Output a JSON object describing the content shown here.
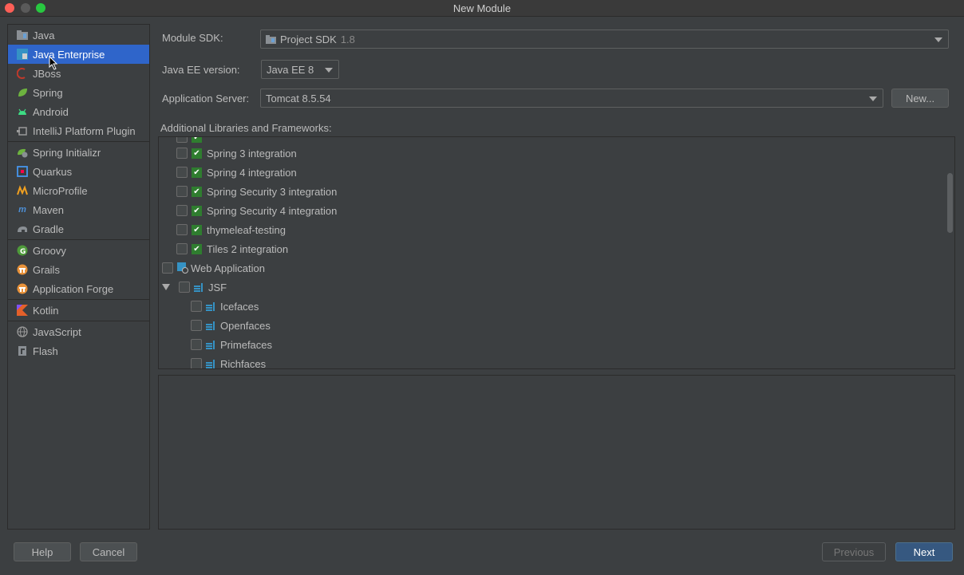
{
  "window": {
    "title": "New Module"
  },
  "sidebar": {
    "items": [
      {
        "label": "Java",
        "icon": "folder-icon"
      },
      {
        "label": "Java Enterprise",
        "icon": "java-ee-icon",
        "selected": true
      },
      {
        "label": "JBoss",
        "icon": "jboss-icon"
      },
      {
        "label": "Spring",
        "icon": "spring-leaf-icon"
      },
      {
        "label": "Android",
        "icon": "android-icon"
      },
      {
        "label": "IntelliJ Platform Plugin",
        "icon": "plugin-icon"
      },
      {
        "label": "Spring Initializr",
        "icon": "spring-initializr-icon"
      },
      {
        "label": "Quarkus",
        "icon": "quarkus-icon"
      },
      {
        "label": "MicroProfile",
        "icon": "microprofile-icon"
      },
      {
        "label": "Maven",
        "icon": "maven-icon"
      },
      {
        "label": "Gradle",
        "icon": "gradle-elephant-icon"
      },
      {
        "label": "Groovy",
        "icon": "groovy-icon"
      },
      {
        "label": "Grails",
        "icon": "grails-icon"
      },
      {
        "label": "Application Forge",
        "icon": "forge-icon"
      },
      {
        "label": "Kotlin",
        "icon": "kotlin-icon"
      },
      {
        "label": "JavaScript",
        "icon": "globe-icon"
      },
      {
        "label": "Flash",
        "icon": "flash-file-icon"
      }
    ]
  },
  "form": {
    "module_sdk_label": "Module SDK:",
    "module_sdk_value": "Project SDK",
    "module_sdk_version": "1.8",
    "javaee_label": "Java EE version:",
    "javaee_value": "Java EE 8",
    "appserver_label": "Application Server:",
    "appserver_value": "Tomcat 8.5.54",
    "new_button": "New...",
    "libraries_label": "Additional Libraries and Frameworks:"
  },
  "tree": {
    "rows": [
      {
        "label": "Spring 3 integration",
        "checked": false,
        "lib": true
      },
      {
        "label": "Spring 4 integration",
        "checked": false,
        "lib": true
      },
      {
        "label": "Spring Security 3 integration",
        "checked": false,
        "lib": true
      },
      {
        "label": "Spring Security 4 integration",
        "checked": false,
        "lib": true
      },
      {
        "label": "thymeleaf-testing",
        "checked": false,
        "lib": true
      },
      {
        "label": "Tiles 2 integration",
        "checked": false,
        "lib": true
      },
      {
        "label": "Web Application",
        "checked": false
      },
      {
        "label": "JSF",
        "checked": false,
        "expanded": true
      },
      {
        "label": "Icefaces",
        "checked": false
      },
      {
        "label": "Openfaces",
        "checked": false
      },
      {
        "label": "Primefaces",
        "checked": false
      },
      {
        "label": "Richfaces",
        "checked": false
      }
    ]
  },
  "footer": {
    "help": "Help",
    "cancel": "Cancel",
    "previous": "Previous",
    "next": "Next"
  },
  "colors": {
    "selection": "#2f65ca",
    "primary_button": "#365880",
    "library_check": "#2f7d2f"
  }
}
